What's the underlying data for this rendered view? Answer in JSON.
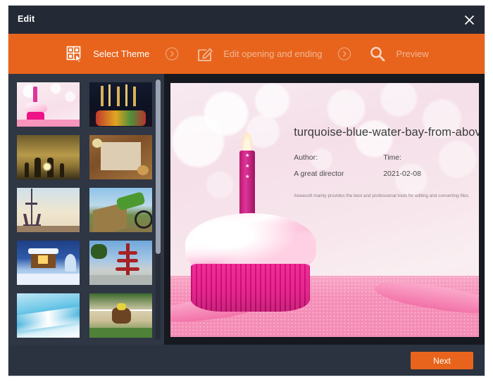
{
  "window": {
    "title": "Edit",
    "close_icon": "close-icon"
  },
  "steps": {
    "separator_icon": "chevron-right-circle-icon",
    "items": [
      {
        "label": "Select Theme",
        "icon": "theme-grid-cursor-icon",
        "state": "active"
      },
      {
        "label": "Edit opening and ending",
        "icon": "edit-pencil-square-icon",
        "state": "inactive"
      },
      {
        "label": "Preview",
        "icon": "magnifier-icon",
        "state": "inactive"
      }
    ]
  },
  "theme_panel": {
    "scrollbar": "vertical-scrollbar",
    "thumbnails": [
      {
        "name": "pink-cupcake-theme",
        "selected": true
      },
      {
        "name": "candles-dinner-theme",
        "selected": false
      },
      {
        "name": "family-sunset-silhouette-theme",
        "selected": false
      },
      {
        "name": "christmas-cookies-theme",
        "selected": false
      },
      {
        "name": "eiffel-tower-theme",
        "selected": false
      },
      {
        "name": "motocross-jump-theme",
        "selected": false
      },
      {
        "name": "snow-cabin-new-year-theme",
        "selected": false
      },
      {
        "name": "japan-pagoda-fuji-theme",
        "selected": false
      },
      {
        "name": "blue-sky-gradient-theme",
        "selected": false
      },
      {
        "name": "horse-racing-theme",
        "selected": false
      }
    ]
  },
  "preview": {
    "title": "turquoise-blue-water-bay-from-abov...",
    "author_label": "Author:",
    "author_value": "A great director",
    "time_label": "Time:",
    "time_value": "2021-02-08",
    "footnote": "Aiseesoft mainly provides the best and professional tools for editing and converting files."
  },
  "footer": {
    "next_label": "Next"
  },
  "colors": {
    "accent": "#e8641c",
    "title_bar": "#242a35",
    "window_bg": "#2b3240",
    "panel_bg": "#2f3644",
    "preview_bg": "#16191f"
  }
}
